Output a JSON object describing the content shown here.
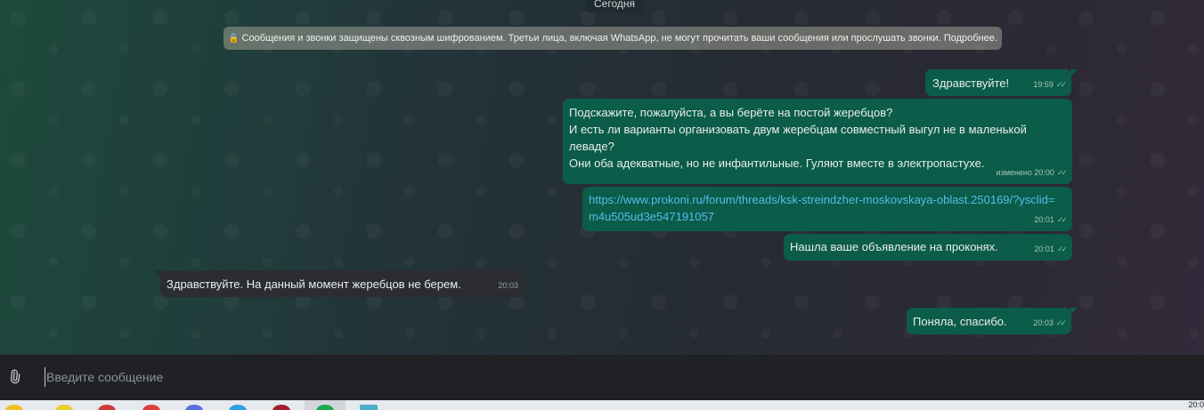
{
  "chat": {
    "date_label": "Сегодня",
    "encryption_notice": "Сообщения и звонки защищены сквозным шифрованием. Третьи лица, включая WhatsApp, не могут прочитать ваши сообщения или прослушать звонки. Подробнее."
  },
  "messages": [
    {
      "direction": "outgoing",
      "text": "Здравствуйте!",
      "time": "19:59",
      "status": "read"
    },
    {
      "direction": "outgoing",
      "text": "Подскажите, пожалуйста, а вы берёте на постой жеребцов?\nИ есть ли варианты организовать двум жеребцам совместный выгул не в маленькой леваде?\nОни оба адекватные, но не инфантильные. Гуляют вместе в электропастухе.",
      "edited_label": "изменено",
      "time": "20:00",
      "status": "read"
    },
    {
      "direction": "outgoing",
      "text": "https://www.prokoni.ru/forum/threads/ksk-streindzher-moskovskaya-oblast.250169/?ysclid=m4u505ud3e547191057",
      "time": "20:01",
      "status": "read"
    },
    {
      "direction": "outgoing",
      "text": "Нашла ваше объявление на проконях.",
      "time": "20:01",
      "status": "read"
    },
    {
      "direction": "incoming",
      "text": "Здравствуйте. На данный момент жеребцов не берем.",
      "time": "20:03"
    },
    {
      "direction": "outgoing",
      "text": "Поняла, спасибо.",
      "time": "20:03",
      "status": "read"
    }
  ],
  "composer": {
    "placeholder": "Введите сообщение",
    "attach_icon": "paperclip-icon"
  },
  "icons": {
    "lock": "🔒",
    "ticks": "✓✓",
    "paperclip": "⌀"
  },
  "taskbar": {
    "clock": "20:0"
  },
  "colors": {
    "outgoing_bubble": "#0b5c49",
    "incoming_bubble": "#2b2d31",
    "link": "#53bdeb"
  }
}
